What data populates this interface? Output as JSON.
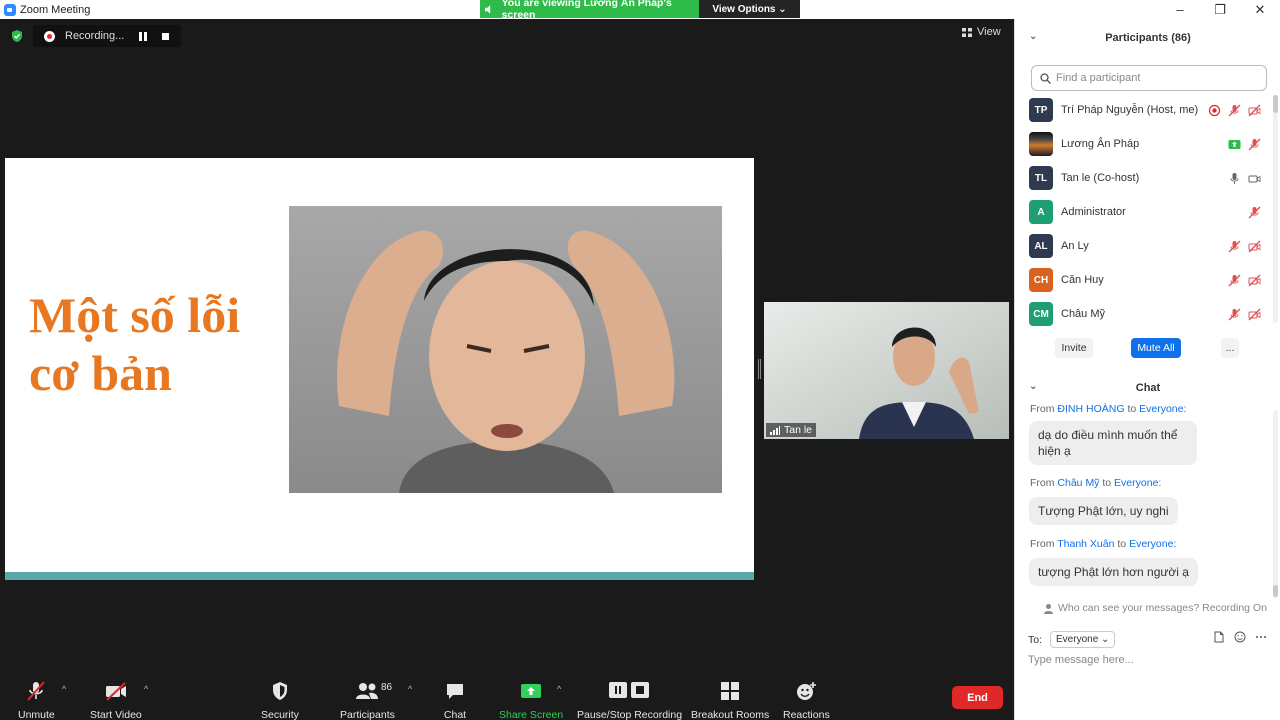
{
  "window": {
    "title": "Zoom Meeting",
    "controls": [
      "–",
      "❐",
      "✕"
    ]
  },
  "banner": {
    "viewing_text": "You are viewing Lương Ân Pháp's screen",
    "view_options": "View Options ⌄"
  },
  "recording": {
    "label": "Recording..."
  },
  "view_button": {
    "label": "View"
  },
  "slide": {
    "title": "Một số lỗi cơ bản"
  },
  "video": {
    "name": "Tan le"
  },
  "toolbar": {
    "unmute": "Unmute",
    "start_video": "Start Video",
    "security": "Security",
    "participants": "Participants",
    "participants_count": "86",
    "chat": "Chat",
    "share_screen": "Share Screen",
    "pause_recording": "Pause/Stop Recording",
    "breakout_rooms": "Breakout Rooms",
    "reactions": "Reactions",
    "end": "End",
    "caret": "^"
  },
  "participants_panel": {
    "title": "Participants (86)",
    "search_placeholder": "Find a participant",
    "items": [
      {
        "initials": "TP",
        "name": "Trí Pháp Nguyễn (Host, me)",
        "color": "#2e3a4f"
      },
      {
        "initials": "",
        "name": "Lương Ân Pháp",
        "color": "#1b1b2a"
      },
      {
        "initials": "TL",
        "name": "Tan le (Co-host)",
        "color": "#2e3a4f"
      },
      {
        "initials": "A",
        "name": "Administrator",
        "color": "#1e9e75"
      },
      {
        "initials": "AL",
        "name": "An Ly",
        "color": "#2e3a4f"
      },
      {
        "initials": "CH",
        "name": "Căn Huy",
        "color": "#d9621e"
      },
      {
        "initials": "CM",
        "name": "Châu Mỹ",
        "color": "#1e9e75"
      }
    ],
    "invite": "Invite",
    "mute_all": "Mute All",
    "more": "..."
  },
  "chat_panel": {
    "title": "Chat",
    "messages": [
      {
        "from_prefix": "From",
        "from": "ĐỊNH HOÀNG",
        "to_word": "to",
        "to": "Everyone:",
        "text": "dạ do điều mình muốn thể hiện ạ"
      },
      {
        "from_prefix": "From",
        "from": "Châu Mỹ",
        "to_word": "to",
        "to": "Everyone:",
        "text": "Tượng Phật lớn, uy nghi"
      },
      {
        "from_prefix": "From",
        "from": "Thanh Xuân",
        "to_word": "to",
        "to": "Everyone:",
        "text": "tượng Phật lớn hơn người ạ"
      }
    ],
    "who_can_see": "Who can see your messages? Recording On",
    "to_label": "To:",
    "to_value": "Everyone ⌄",
    "type_placeholder": "Type message here..."
  }
}
